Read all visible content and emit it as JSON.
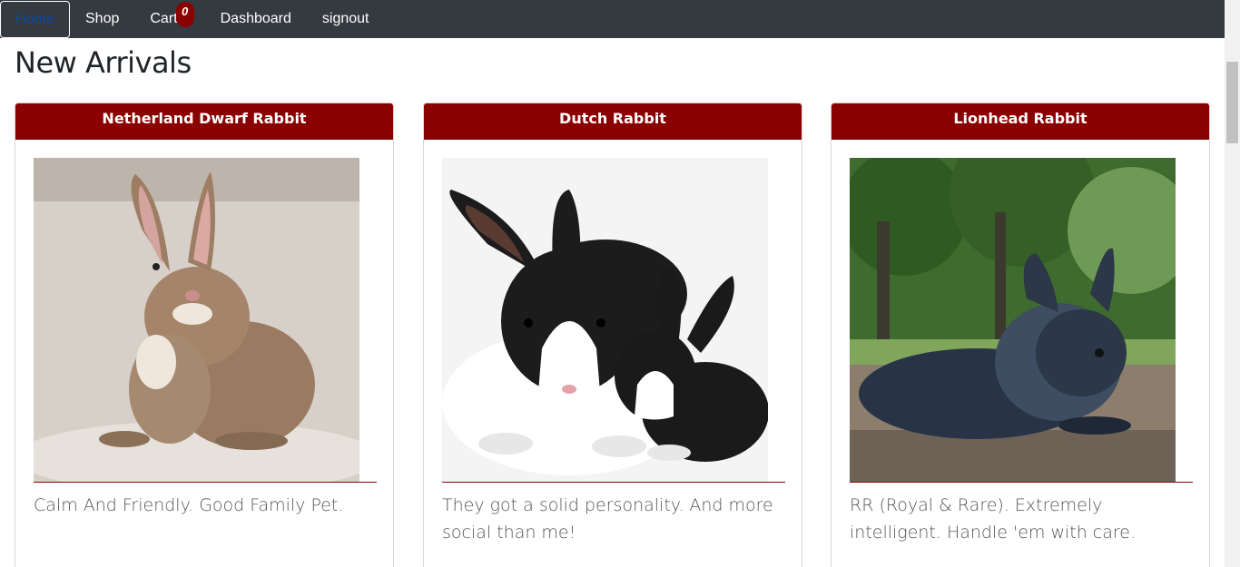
{
  "nav": {
    "items": [
      {
        "label": "Home",
        "active": true
      },
      {
        "label": "Shop"
      },
      {
        "label": "Cart",
        "badge": "0"
      },
      {
        "label": "Dashboard"
      },
      {
        "label": "signout"
      }
    ]
  },
  "page": {
    "title": "New Arrivals"
  },
  "products": [
    {
      "name": "Netherland Dwarf Rabbit",
      "description": "Calm And Friendly. Good Family Pet.",
      "image": "netherland-dwarf-rabbit-photo"
    },
    {
      "name": "Dutch Rabbit",
      "description": "They got a solid personality. And more social than me!",
      "image": "dutch-rabbit-photo"
    },
    {
      "name": "Lionhead Rabbit",
      "description": "RR (Royal & Rare). Extremely intelligent. Handle 'em with care.",
      "image": "lionhead-rabbit-photo"
    }
  ],
  "colors": {
    "navbar": "#343a40",
    "accent": "#8b0000",
    "active_link": "#0d47a1"
  }
}
